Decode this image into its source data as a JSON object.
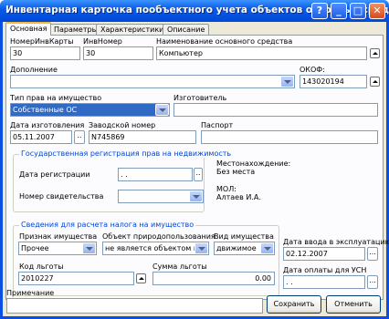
{
  "window": {
    "title": "Инвентарная карточка пообъектного учета объектов основных средств"
  },
  "title_buttons": {
    "help": "?",
    "minimize": "_",
    "maximize": "□",
    "close": "✕"
  },
  "tabs": [
    "Основная",
    "Параметры",
    "Характеристики",
    "Описание"
  ],
  "fields": {
    "inv_card_no": {
      "label": "НомерИнвКарты",
      "value": "30"
    },
    "inv_no": {
      "label": "ИнвНомер",
      "value": "30"
    },
    "asset_name": {
      "label": "Наименование основного средства",
      "value": "Компьютер"
    },
    "addition": {
      "label": "Дополнение",
      "value": ""
    },
    "okof": {
      "label": "ОКОФ:",
      "value": "143020194"
    },
    "rights_type": {
      "label": "Тип прав на имущество",
      "value": "Собственные ОС"
    },
    "manufacturer": {
      "label": "Изготовитель",
      "value": ""
    },
    "made_date": {
      "label": "Дата изготовления",
      "value": "05.11.2007"
    },
    "serial_no": {
      "label": "Заводской номер",
      "value": "N745869"
    },
    "passport": {
      "label": "Паспорт",
      "value": ""
    }
  },
  "registration": {
    "title": "Государственная регистрация прав на недвижимость",
    "reg_date": {
      "label": "Дата регистрации",
      "value": " .  ."
    },
    "cert_no": {
      "label": "Номер свидетельства",
      "value": ""
    }
  },
  "location": {
    "label": "Местонахождение:",
    "value": "Без места"
  },
  "mol": {
    "label": "МОЛ:",
    "value": "Алтаев И.А."
  },
  "tax": {
    "title": "Сведения для расчета налога на имущество",
    "property_sign": {
      "label": "Признак имущества",
      "value": "Прочее"
    },
    "nature_object": {
      "label": "Объект природопользования",
      "value": "не является объектом пр"
    },
    "property_kind": {
      "label": "Вид имущества",
      "value": "движимое"
    },
    "commission_date": {
      "label": "Дата ввода в эксплуатацию",
      "value": "02.12.2007"
    },
    "benefit_code": {
      "label": "Код льготы",
      "value": "2010227"
    },
    "benefit_sum": {
      "label": "Сумма льготы",
      "value": "0.00"
    },
    "usn_pay_date": {
      "label": "Дата оплаты для УСН",
      "value": " .  ."
    }
  },
  "note": {
    "label": "Примечание",
    "value": ""
  },
  "buttons": {
    "save": "Сохранить",
    "cancel": "Отменить",
    "ellipsis": "...",
    "ellipsis_small": ".."
  },
  "colors": {
    "titlebar": "#0a5be8",
    "group_title": "#0046d5",
    "selection": "#316ac5",
    "active_tab_accent": "#f6b93c"
  }
}
